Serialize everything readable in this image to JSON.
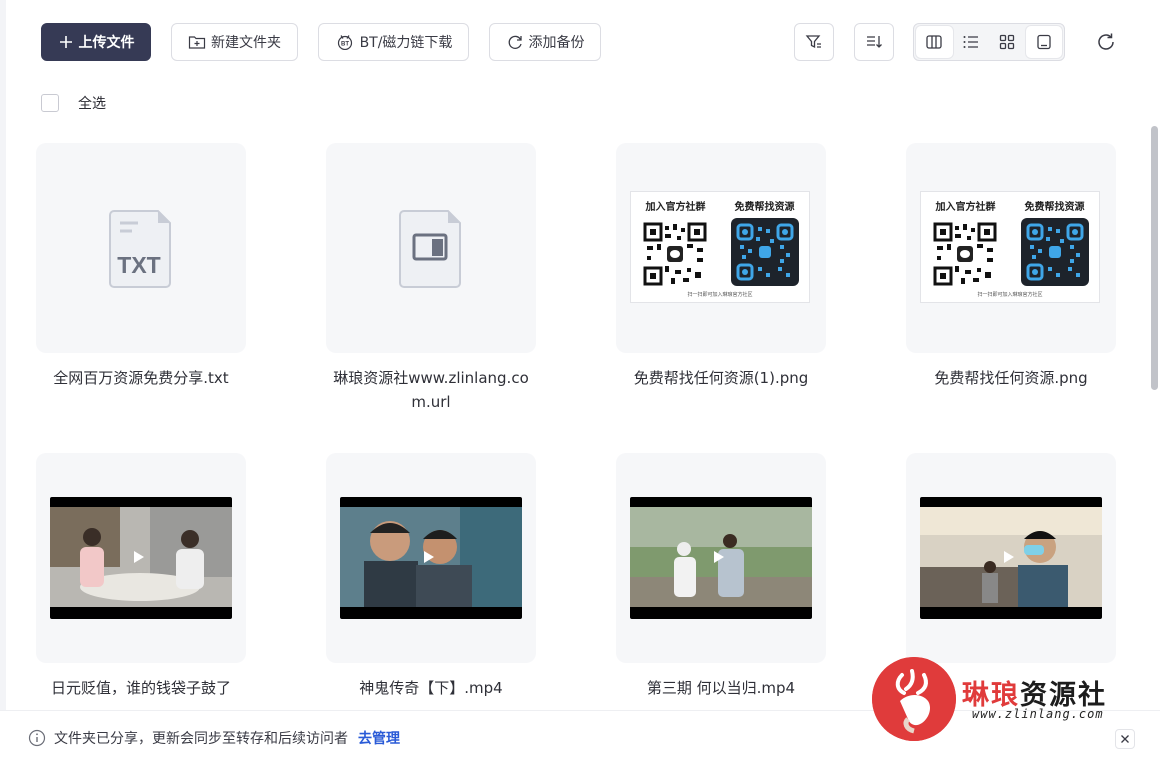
{
  "toolbar": {
    "upload_label": "上传文件",
    "new_folder_label": "新建文件夹",
    "bt_label": "BT/磁力链下载",
    "backup_label": "添加备份"
  },
  "select_all_label": "全选",
  "files": [
    {
      "name": "全网百万资源免费分享.txt",
      "type": "txt",
      "icon_text": "TXT"
    },
    {
      "name": "琳琅资源社www.zlinlang.com.url",
      "type": "url"
    },
    {
      "name": "免费帮找任何资源(1).png",
      "type": "image"
    },
    {
      "name": "免费帮找任何资源.png",
      "type": "image"
    },
    {
      "name": "日元贬值，谁的钱袋子鼓了",
      "type": "video"
    },
    {
      "name": "神鬼传奇【下】.mp4",
      "type": "video"
    },
    {
      "name": "第三期 何以当归.mp4",
      "type": "video"
    },
    {
      "name": "",
      "type": "video"
    }
  ],
  "poster": {
    "left_title": "加入官方社群",
    "right_title": "免费帮找资源",
    "footer": "扫一扫即可加入琳琅官方社区"
  },
  "notice": {
    "text": "文件夹已分享，更新会同步至转存和后续访问者",
    "link": "去管理"
  },
  "watermark": {
    "part1": "琳琅",
    "part2": "资源社",
    "url": "www.zlinlang.com"
  },
  "colors": {
    "primary": "#363a55",
    "link": "#2a5bd7",
    "brand_red": "#e03b3b"
  }
}
